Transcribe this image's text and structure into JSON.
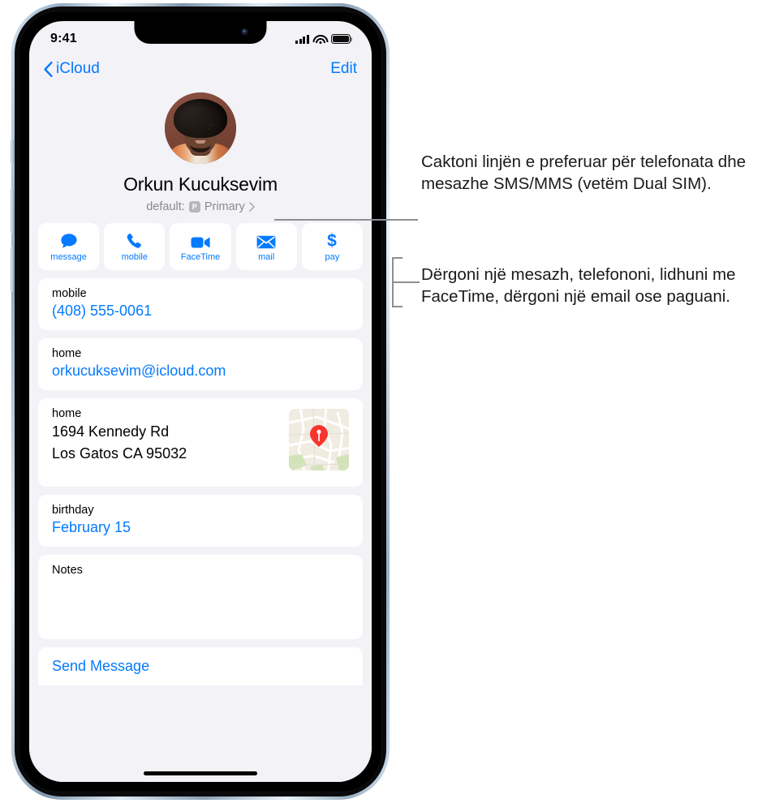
{
  "status_bar": {
    "time": "9:41",
    "signal_icon": "cellular-signal-icon",
    "wifi_icon": "wifi-icon",
    "battery_icon": "battery-icon"
  },
  "nav": {
    "back_label": "iCloud",
    "back_icon": "chevron-left-icon",
    "edit_label": "Edit"
  },
  "contact": {
    "avatar_name": "contact-avatar",
    "name": "Orkun Kucuksevim",
    "default_prefix": "default:",
    "sim_badge": "P",
    "default_value": "Primary",
    "chevron_icon": "chevron-right-icon"
  },
  "actions": [
    {
      "label": "message",
      "icon": "message-bubble-icon"
    },
    {
      "label": "mobile",
      "icon": "phone-handset-icon"
    },
    {
      "label": "FaceTime",
      "icon": "video-camera-icon"
    },
    {
      "label": "mail",
      "icon": "envelope-icon"
    },
    {
      "label": "pay",
      "icon": "dollar-sign-icon"
    }
  ],
  "fields": {
    "phone": {
      "label": "mobile",
      "value": "(408) 555-0061"
    },
    "email": {
      "label": "home",
      "value": "orkucuksevim@icloud.com"
    },
    "address": {
      "label": "home",
      "line1": "1694 Kennedy Rd",
      "line2": "Los Gatos CA 95032",
      "map_icon": "map-thumbnail",
      "pin_icon": "map-pin-icon"
    },
    "birthday": {
      "label": "birthday",
      "value": "February 15"
    },
    "notes": {
      "label": "Notes",
      "value": ""
    },
    "send_message": {
      "label": "Send Message"
    }
  },
  "callouts": {
    "one": "Caktoni linjën e preferuar për telefonata dhe mesazhe SMS/MMS (vetëm Dual SIM).",
    "two": "Dërgoni një mesazh, telefononi, lidhuni me FaceTime, dërgoni një email ose paguani."
  },
  "colors": {
    "accent_blue": "#037aff",
    "screen_background": "#f2f2f7",
    "card_background": "#ffffff",
    "secondary_text": "#8a8a8e",
    "callout_line": "#8e8e93",
    "map_pin_red": "#f6352e"
  }
}
